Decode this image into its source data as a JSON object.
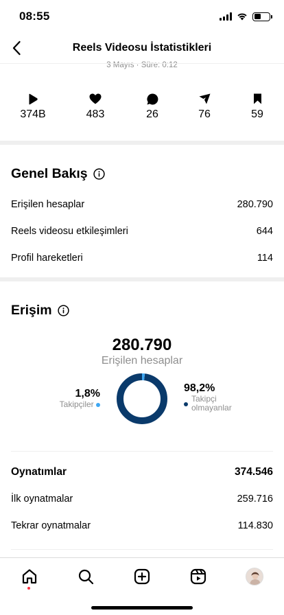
{
  "status_bar": {
    "time": "08:55"
  },
  "header": {
    "title": "Reels Videosu İstatistikleri",
    "subtitle": "3 Mayıs · Süre: 0:12"
  },
  "stats": [
    {
      "icon": "play-icon",
      "value": "374B"
    },
    {
      "icon": "heart-icon",
      "value": "483"
    },
    {
      "icon": "comment-icon",
      "value": "26"
    },
    {
      "icon": "share-icon",
      "value": "76"
    },
    {
      "icon": "bookmark-icon",
      "value": "59"
    }
  ],
  "overview": {
    "title": "Genel Bakış",
    "rows": [
      {
        "label": "Erişilen hesaplar",
        "value": "280.790"
      },
      {
        "label": "Reels videosu etkileşimleri",
        "value": "644"
      },
      {
        "label": "Profil hareketleri",
        "value": "114"
      }
    ]
  },
  "reach": {
    "title": "Erişim",
    "total": "280.790",
    "total_label": "Erişilen hesaplar",
    "followers": {
      "percent": "1,8%",
      "label": "Takipçiler",
      "fraction": 0.018
    },
    "non_followers": {
      "percent": "98,2%",
      "label_line1": "Takipçi",
      "label_line2": "olmayanlar",
      "fraction": 0.982
    },
    "colors": {
      "followers": "#3ea7f2",
      "non_followers": "#0a3a6b"
    }
  },
  "plays": {
    "title": "Oynatımlar",
    "total": "374.546",
    "rows": [
      {
        "label": "İlk oynatmalar",
        "value": "259.716"
      },
      {
        "label": "Tekrar oynatmalar",
        "value": "114.830"
      }
    ]
  },
  "tab_bar": {
    "tabs": [
      "home-icon",
      "search-icon",
      "create-icon",
      "reels-icon",
      "profile-avatar"
    ],
    "notification_dot_color": "#ff3040"
  }
}
